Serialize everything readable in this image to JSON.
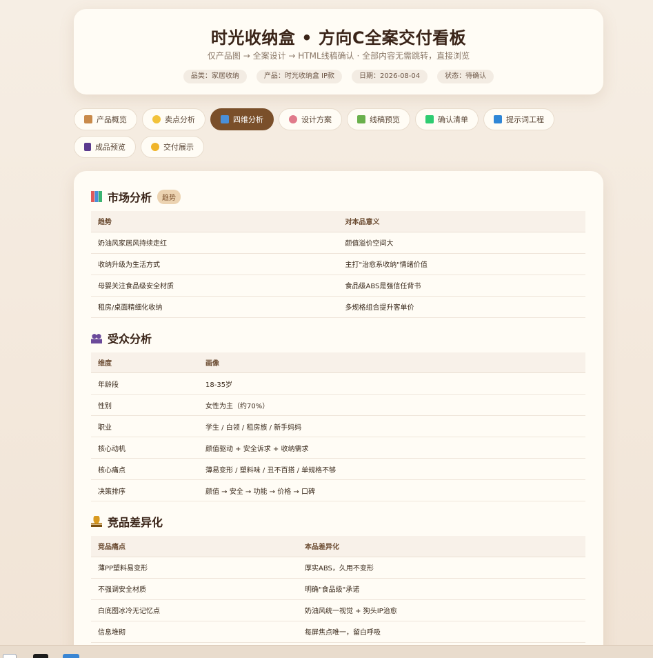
{
  "header": {
    "title": "时光收纳盒 • 方向C全案交付看板",
    "subtitle": "仅产品图 → 全案设计 → HTML线稿确认 · 全部内容无需跳转，直接浏览",
    "meta": [
      "品类：家居收纳",
      "产品：时光收纳盒 IP款",
      "日期：2026-08-04",
      "状态：待确认"
    ]
  },
  "tabs": [
    {
      "label": "产品概览",
      "icon": "box-icon",
      "color": "#c98a4a"
    },
    {
      "label": "卖点分析",
      "icon": "lightbulb-icon",
      "color": "#f2c23a"
    },
    {
      "label": "四维分析",
      "icon": "bar-chart-icon",
      "color": "#4a8fd8",
      "active": true
    },
    {
      "label": "设计方案",
      "icon": "palette-icon",
      "color": "#e07a8a"
    },
    {
      "label": "线稿预览",
      "icon": "picture-icon",
      "color": "#6ab04c"
    },
    {
      "label": "确认清单",
      "icon": "checkbox-icon",
      "color": "#2ecc71"
    },
    {
      "label": "提示词工程",
      "icon": "abc-icon",
      "color": "#2f86d6"
    },
    {
      "label": "成品预览",
      "icon": "phone-icon",
      "color": "#5b3a8e"
    },
    {
      "label": "交付展示",
      "icon": "sparkles-icon",
      "color": "#f0b429"
    }
  ],
  "sections": {
    "market": {
      "title": "市场分析",
      "badge": "趋势",
      "headers": [
        "趋势",
        "对本品意义"
      ],
      "rows": [
        [
          "奶油风家居风持续走红",
          "颜值溢价空间大"
        ],
        [
          "收纳升级为生活方式",
          "主打\"治愈系收纳\"情绪价值"
        ],
        [
          "母婴关注食品级安全材质",
          "食品级ABS是强信任背书"
        ],
        [
          "租房/桌面精细化收纳",
          "多规格组合提升客单价"
        ]
      ]
    },
    "audience": {
      "title": "受众分析",
      "headers": [
        "维度",
        "画像"
      ],
      "rows": [
        [
          "年龄段",
          "18-35岁"
        ],
        [
          "性别",
          "女性为主（约70%）"
        ],
        [
          "职业",
          "学生 / 白领 / 租房族 / 新手妈妈"
        ],
        [
          "核心动机",
          "颜值驱动 + 安全诉求 + 收纳需求"
        ],
        [
          "核心痛点",
          "薄易变形 / 塑料味 / 丑不百搭 / 单规格不够"
        ],
        [
          "决策排序",
          "颜值 → 安全 → 功能 → 价格 → 口碑"
        ]
      ]
    },
    "competitor": {
      "title": "竞品差异化",
      "headers": [
        "竞品痛点",
        "本品差异化"
      ],
      "rows": [
        [
          "薄PP塑料易变形",
          "厚实ABS，久用不变形"
        ],
        [
          "不强调安全材质",
          "明确\"食品级\"承诺"
        ],
        [
          "白底图冰冷无记忆点",
          "奶油风统一视觉 + 狗头IP治愈"
        ],
        [
          "信息堆砌",
          "每屏焦点唯一，留白呼吸"
        ]
      ]
    }
  }
}
